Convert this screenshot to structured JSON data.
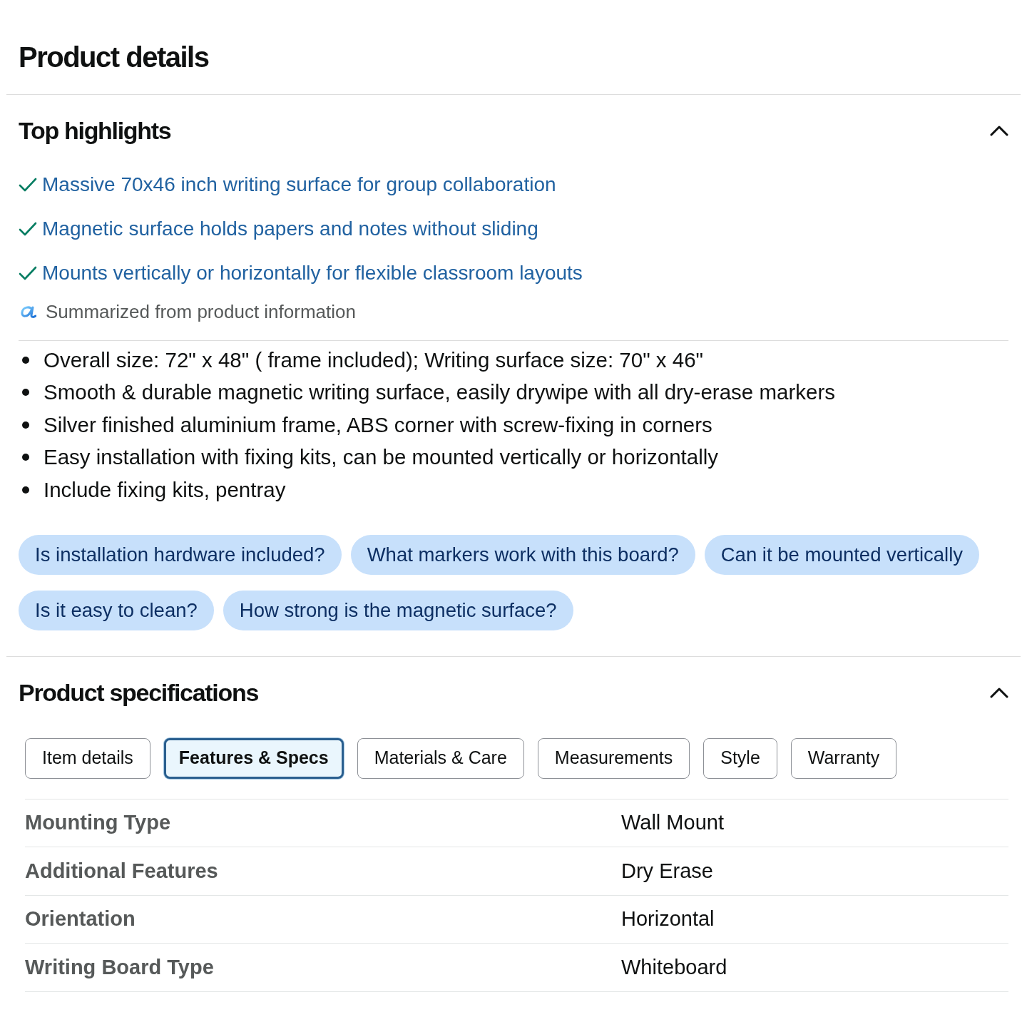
{
  "title": "Product details",
  "top_highlights": {
    "title": "Top highlights",
    "expanded": true,
    "highlights": [
      "Massive 70x46 inch writing surface for group collaboration",
      "Magnetic surface holds papers and notes without sliding",
      "Mounts vertically or horizontally for flexible classroom layouts"
    ],
    "summary_note": "Summarized from product information",
    "bullets": [
      "Overall size: 72\" x 48\" ( frame included); Writing surface size: 70\" x 46\"",
      "Smooth & durable magnetic writing surface, easily drywipe with all dry-erase markers",
      "Silver finished aluminium frame, ABS corner with screw-fixing in corners",
      "Easy installation with fixing kits, can be mounted vertically or horizontally",
      "Include fixing kits, pentray"
    ],
    "question_rows": [
      [
        "Is installation hardware included?",
        "What markers work with this board?",
        "Can it be mounted vertically"
      ],
      [
        "Is it easy to clean?",
        "How strong is the magnetic surface?"
      ]
    ]
  },
  "product_specifications": {
    "title": "Product specifications",
    "expanded": true,
    "tabs": [
      {
        "label": "Item details",
        "selected": false
      },
      {
        "label": "Features & Specs",
        "selected": true
      },
      {
        "label": "Materials & Care",
        "selected": false
      },
      {
        "label": "Measurements",
        "selected": false
      },
      {
        "label": "Style",
        "selected": false
      },
      {
        "label": "Warranty",
        "selected": false
      }
    ],
    "rows": [
      {
        "label": "Mounting Type",
        "value": "Wall Mount"
      },
      {
        "label": "Additional Features",
        "value": "Dry Erase"
      },
      {
        "label": "Orientation",
        "value": "Horizontal"
      },
      {
        "label": "Writing Board Type",
        "value": "Whiteboard"
      }
    ]
  }
}
